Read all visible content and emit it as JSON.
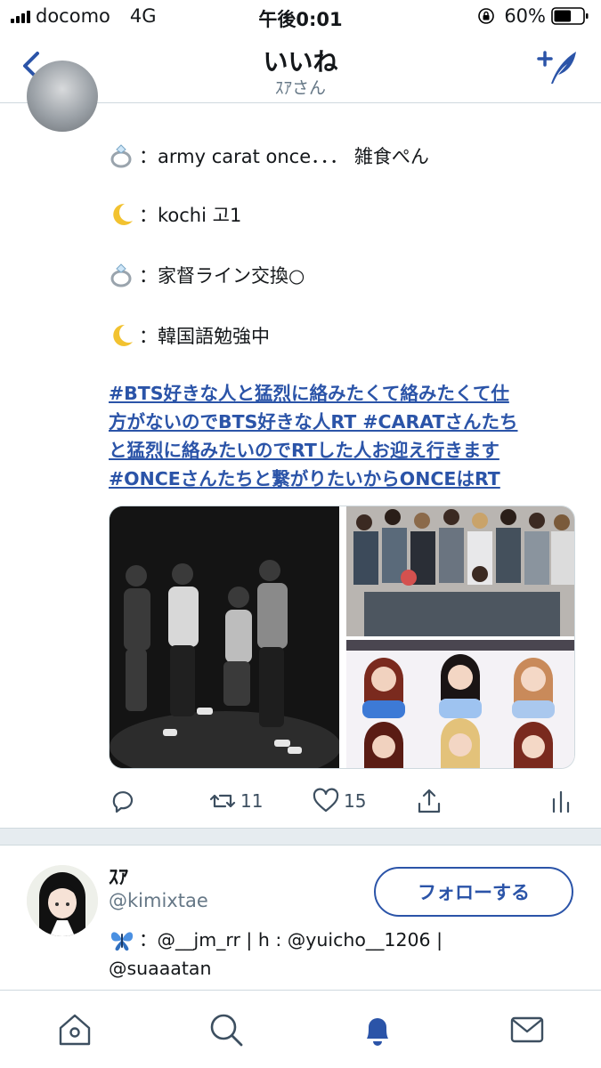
{
  "status_bar": {
    "carrier": "docomo",
    "network": "4G",
    "time": "午後0:01",
    "battery": "60%",
    "battery_level": 0.6
  },
  "header": {
    "title": "いいね",
    "subtitle": "ｽｱさん",
    "back_icon": "chevron-left-icon",
    "compose_icon": "compose-feather-icon"
  },
  "tweet": {
    "partial_text": "",
    "bio_lines": [
      {
        "emoji": "ring-icon",
        "text": "：army carat once．．．  雑食ぺん"
      },
      {
        "emoji": "crescent-moon-icon",
        "text": "：kochi  고1"
      },
      {
        "emoji": "ring-icon",
        "text": "：家督ライン交換○"
      },
      {
        "emoji": "crescent-moon-icon",
        "text": "：韓国語勉強中"
      }
    ],
    "hashtag_lines": [
      "#BTS好きな人と猛烈に絡みたくて絡みたくて仕",
      "方がないのでBTS好きな人RT #CARATさんたち",
      "と猛烈に絡みたいのでRTした人お迎え行きます",
      "#ONCEさんたちと繋がりたいからONCEはRT"
    ],
    "media": [
      "bw-group-photo",
      "group-photo",
      "group-photo"
    ],
    "actions": {
      "reply_icon": "reply-icon",
      "retweet_icon": "retweet-icon",
      "retweet_count": "11",
      "like_icon": "heart-icon",
      "like_count": "15",
      "share_icon": "share-icon",
      "stats_icon": "stats-icon"
    }
  },
  "user_card": {
    "name": "ｽｱ",
    "handle": "@kimixtae",
    "follow_label": "フォローする",
    "bio_emoji": "butterfly-icon",
    "bio_line1": "：@__jm_rr | h : @yuicho__1206 |",
    "bio_line2": "@suaaatan"
  },
  "tab_bar": {
    "items": [
      "home-icon",
      "search-icon",
      "notifications-icon",
      "messages-icon"
    ],
    "active": "notifications-icon"
  },
  "colors": {
    "accent": "#2b54a8",
    "secondary_text": "#657786",
    "divider": "#cfd9de",
    "band": "#e6ecf0"
  }
}
